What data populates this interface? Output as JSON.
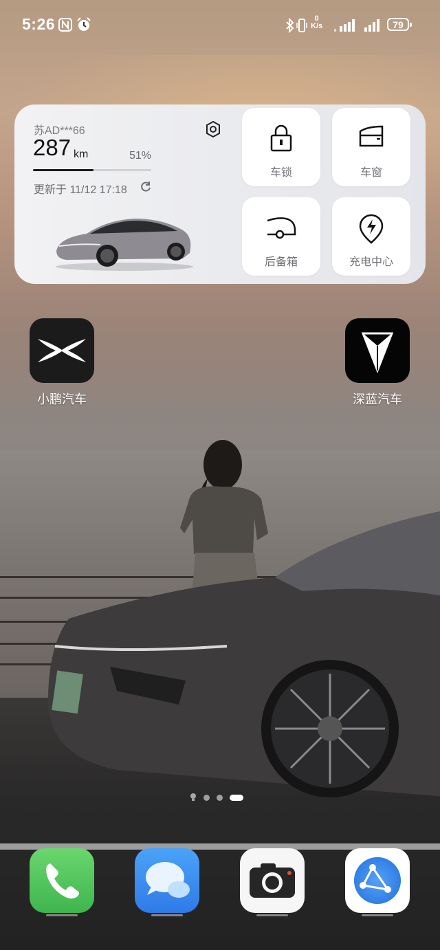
{
  "status_bar": {
    "time": "5:26",
    "speed_value": "0",
    "speed_unit": "K/s",
    "battery": "79",
    "icons": [
      "nfc-icon",
      "alarm-icon",
      "bluetooth-icon",
      "vibrate-icon",
      "signal-icon",
      "signal-icon"
    ]
  },
  "car_widget": {
    "plate": "苏AD***66",
    "range_value": "287",
    "range_unit": "km",
    "battery_percent": "51%",
    "battery_fraction": 0.51,
    "updated": "更新于 11/12 17:18",
    "controls": [
      {
        "label": "车锁",
        "icon": "lock-icon"
      },
      {
        "label": "车窗",
        "icon": "window-icon"
      },
      {
        "label": "后备箱",
        "icon": "trunk-icon"
      },
      {
        "label": "充电中心",
        "icon": "charging-icon"
      }
    ]
  },
  "apps": [
    {
      "name": "小鹏汽车",
      "icon": "xpeng-logo-icon"
    },
    {
      "name": "深蓝汽车",
      "icon": "deepal-logo-icon"
    }
  ],
  "page_indicator": {
    "pages": 4,
    "active": 3
  },
  "dock": [
    {
      "icon": "phone-icon"
    },
    {
      "icon": "messages-icon"
    },
    {
      "icon": "camera-icon"
    },
    {
      "icon": "browser-icon"
    }
  ],
  "colors": {
    "phone_green": "#4cc85a",
    "messages_blue": "#3a8ef5",
    "browser_blue": "#2f7fe6",
    "widget_bg": "#eeeff2"
  }
}
